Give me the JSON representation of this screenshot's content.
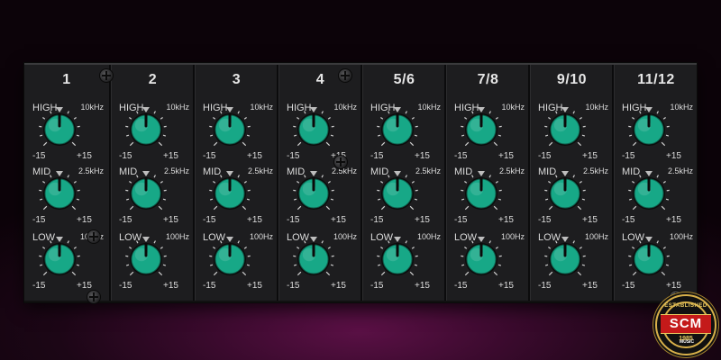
{
  "channels": [
    {
      "label": "1"
    },
    {
      "label": "2"
    },
    {
      "label": "3"
    },
    {
      "label": "4"
    },
    {
      "label": "5/6"
    },
    {
      "label": "7/8"
    },
    {
      "label": "9/10"
    },
    {
      "label": "11/12"
    }
  ],
  "bands": [
    {
      "name": "HIGH",
      "freq": "10kHz"
    },
    {
      "name": "MID",
      "freq": "2.5kHz"
    },
    {
      "name": "LOW",
      "freq": "100Hz"
    }
  ],
  "scale": {
    "min": "-15",
    "max": "+15"
  },
  "colors": {
    "knob": "#17a887",
    "indicator": "#3ad0a8",
    "panel": "#1d1d1f",
    "text": "#dcdcdc",
    "logo_red": "#c41a1a",
    "logo_gold": "#d8b04a"
  },
  "knob_levels": [
    [
      0.5,
      0.5,
      0.5,
      0.5,
      0.5,
      0.5,
      0.5,
      0.5
    ],
    [
      0.5,
      0.5,
      0.5,
      0.5,
      0.5,
      0.5,
      0.5,
      0.5
    ],
    [
      0.5,
      0.5,
      0.5,
      0.5,
      0.5,
      0.5,
      0.5,
      0.5
    ]
  ],
  "logo": {
    "top": "ESTABLISHED",
    "main": "SCM",
    "sub": "MUSIC",
    "year": "1985"
  }
}
